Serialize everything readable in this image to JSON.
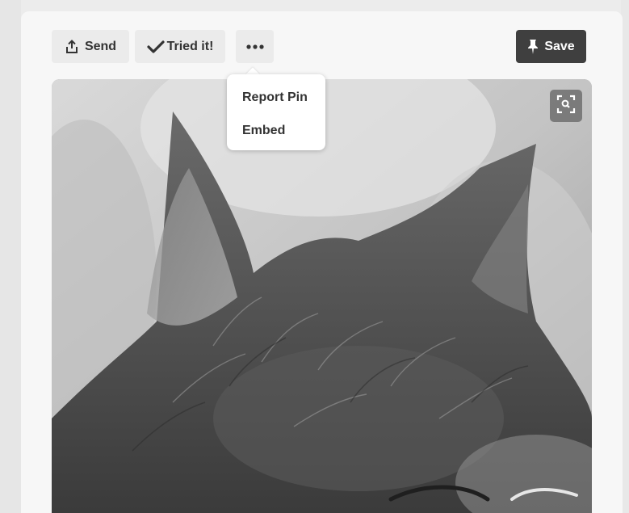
{
  "toolbar": {
    "send_label": "Send",
    "tried_label": "Tried it!",
    "more_label": "•••",
    "save_label": "Save"
  },
  "menu": {
    "items": [
      {
        "label": "Report Pin"
      },
      {
        "label": "Embed"
      }
    ]
  },
  "icons": {
    "send": "share-upload-icon",
    "tried": "checkmark-icon",
    "save": "pushpin-icon",
    "visual_search": "visual-search-icon"
  },
  "colors": {
    "save_button_bg": "#3f3f3f",
    "button_bg": "#ebebeb",
    "text": "#333333"
  }
}
